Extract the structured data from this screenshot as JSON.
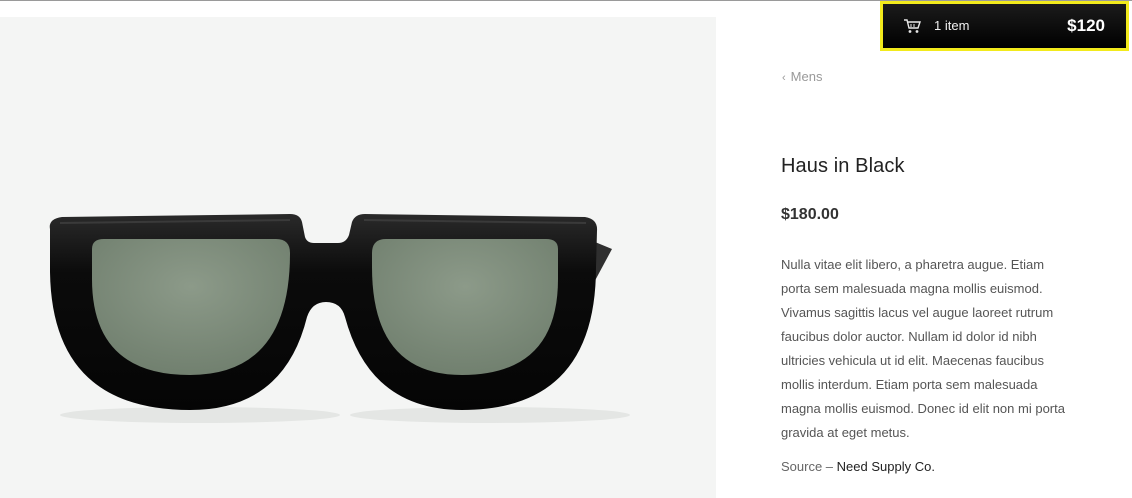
{
  "cart": {
    "count_label": "1 item",
    "total": "$120",
    "icon": "cart-icon",
    "border_color": "#f2ea1c"
  },
  "breadcrumb": {
    "label": "Mens",
    "icon": "chevron-left-icon"
  },
  "product": {
    "title": "Haus in Black",
    "price": "$180.00",
    "description": "Nulla vitae elit libero, a pharetra augue. Etiam porta sem malesuada magna mollis euismod. Vivamus sagittis lacus vel augue laoreet rutrum faucibus dolor auctor. Nullam id dolor id nibh ultricies vehicula ut id elit. Maecenas faucibus mollis interdum. Etiam porta sem malesuada magna mollis euismod. Donec id elit non mi porta gravida at eget metus.",
    "source_prefix": "Source – ",
    "source_name": "Need Supply Co."
  },
  "colors": {
    "image_background": "#f4f5f4",
    "frame": "#0e0e0e",
    "lens": "#7f8e7c"
  }
}
